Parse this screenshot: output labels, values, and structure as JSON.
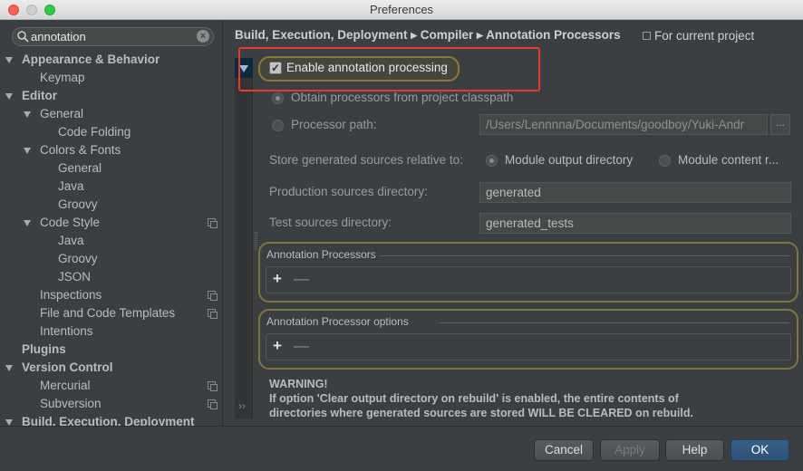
{
  "window": {
    "title": "Preferences"
  },
  "search": {
    "value": "annotation"
  },
  "tree": [
    {
      "label": "Appearance & Behavior",
      "level": 0,
      "bold": true,
      "expanded": true
    },
    {
      "label": "Keymap",
      "level": 1
    },
    {
      "label": "Editor",
      "level": 0,
      "bold": true,
      "expanded": true
    },
    {
      "label": "General",
      "level": 1,
      "expanded": true
    },
    {
      "label": "Code Folding",
      "level": 2
    },
    {
      "label": "Colors & Fonts",
      "level": 1,
      "expanded": true
    },
    {
      "label": "General",
      "level": 2
    },
    {
      "label": "Java",
      "level": 2
    },
    {
      "label": "Groovy",
      "level": 2
    },
    {
      "label": "Code Style",
      "level": 1,
      "expanded": true,
      "project_icon": true
    },
    {
      "label": "Java",
      "level": 2
    },
    {
      "label": "Groovy",
      "level": 2
    },
    {
      "label": "JSON",
      "level": 2
    },
    {
      "label": "Inspections",
      "level": 1,
      "project_icon": true
    },
    {
      "label": "File and Code Templates",
      "level": 1,
      "project_icon": true
    },
    {
      "label": "Intentions",
      "level": 1
    },
    {
      "label": "Plugins",
      "level": 0,
      "bold": true
    },
    {
      "label": "Version Control",
      "level": 0,
      "bold": true,
      "expanded": true
    },
    {
      "label": "Mercurial",
      "level": 1,
      "project_icon": true
    },
    {
      "label": "Subversion",
      "level": 1,
      "project_icon": true
    },
    {
      "label": "Build, Execution, Deployment",
      "level": 0,
      "bold": true,
      "expanded": true
    }
  ],
  "breadcrumb": {
    "path": "Build, Execution, Deployment ▸ Compiler ▸ Annotation Processors",
    "scope": "For current project"
  },
  "settings": {
    "enable_label": "Enable annotation processing",
    "enable_checked": true,
    "obtain_label": "Obtain processors from project classpath",
    "processor_path_label": "Processor path:",
    "processor_path_value": "/Users/Lennnna/Documents/goodboy/Yuki-Andr",
    "browse_label": "...",
    "store_label": "Store generated sources relative to:",
    "module_output_label": "Module output directory",
    "module_content_label": "Module content r...",
    "prod_dir_label": "Production sources directory:",
    "prod_dir_value": "generated",
    "test_dir_label": "Test sources directory:",
    "test_dir_value": "generated_tests"
  },
  "panels": {
    "processors_title": "Annotation Processors",
    "options_title": "Annotation Processor options",
    "add_label": "+",
    "remove_label": "—"
  },
  "warning": {
    "title": "WARNING!",
    "line1": "If option 'Clear output directory on rebuild' is enabled, the entire contents of",
    "line2": "directories where generated sources are stored WILL BE CLEARED on rebuild."
  },
  "buttons": {
    "cancel": "Cancel",
    "apply": "Apply",
    "help": "Help",
    "ok": "OK"
  },
  "colors": {
    "background": "#3c3f41",
    "highlight_box": "#e33b2e",
    "ok_button": "#2f5276"
  }
}
